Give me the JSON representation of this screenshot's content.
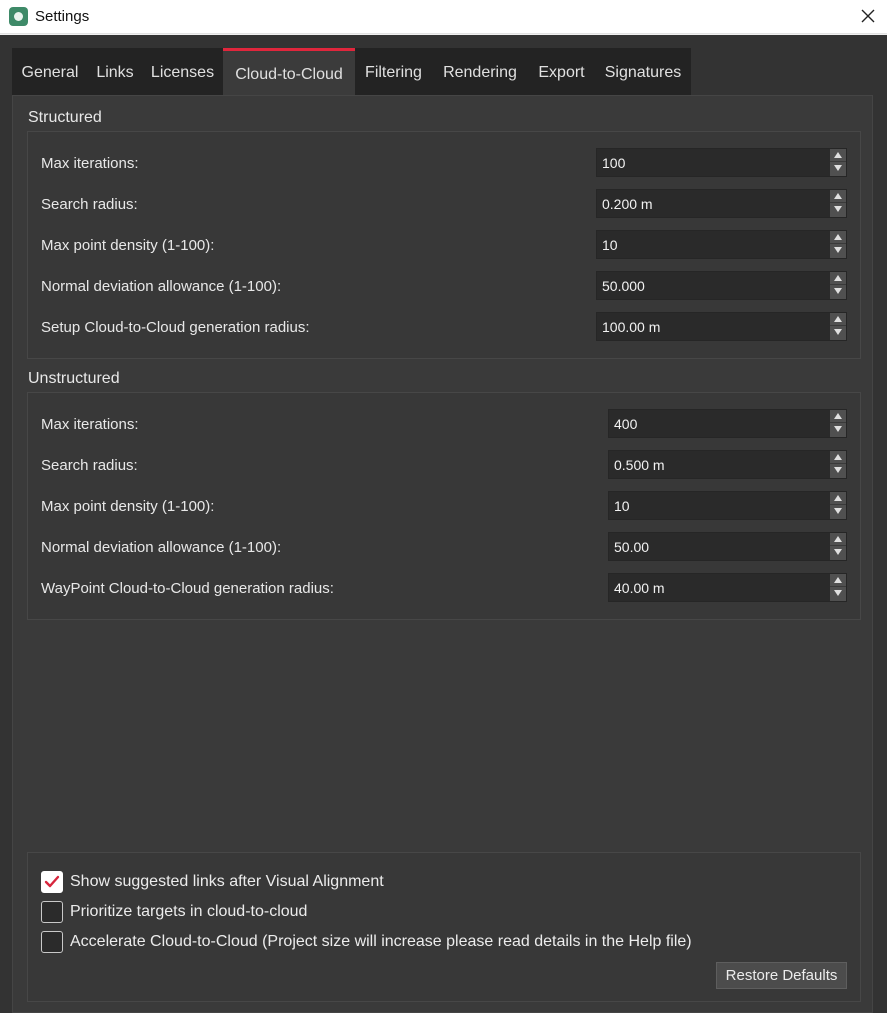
{
  "window": {
    "title": "Settings"
  },
  "tabs": [
    {
      "label": "General"
    },
    {
      "label": "Links"
    },
    {
      "label": "Licenses"
    },
    {
      "label": "Cloud-to-Cloud",
      "active": true
    },
    {
      "label": "Filtering"
    },
    {
      "label": "Rendering"
    },
    {
      "label": "Export"
    },
    {
      "label": "Signatures"
    }
  ],
  "structured": {
    "title": "Structured",
    "rows": [
      {
        "label": "Max iterations:",
        "value": "100"
      },
      {
        "label": "Search radius:",
        "value": "0.200 m"
      },
      {
        "label": "Max point density (1-100):",
        "value": "10"
      },
      {
        "label": "Normal deviation allowance (1-100):",
        "value": "50.000"
      },
      {
        "label": "Setup Cloud-to-Cloud generation radius:",
        "value": "100.00 m"
      }
    ]
  },
  "unstructured": {
    "title": "Unstructured",
    "rows": [
      {
        "label": "Max iterations:",
        "value": "400"
      },
      {
        "label": "Search radius:",
        "value": "0.500 m"
      },
      {
        "label": "Max point density (1-100):",
        "value": "10"
      },
      {
        "label": "Normal deviation allowance (1-100):",
        "value": "50.00"
      },
      {
        "label": "WayPoint Cloud-to-Cloud generation radius:",
        "value": "40.00 m"
      }
    ]
  },
  "options": [
    {
      "label": "Show suggested links after Visual Alignment",
      "checked": true
    },
    {
      "label": "Prioritize targets in cloud-to-cloud",
      "checked": false
    },
    {
      "label": "Accelerate Cloud-to-Cloud (Project size will increase please read details in the Help file)",
      "checked": false
    }
  ],
  "restore_defaults_label": "Restore Defaults",
  "colors": {
    "accent": "#e0263c",
    "background": "#333333",
    "panel": "#3a3a3a"
  }
}
